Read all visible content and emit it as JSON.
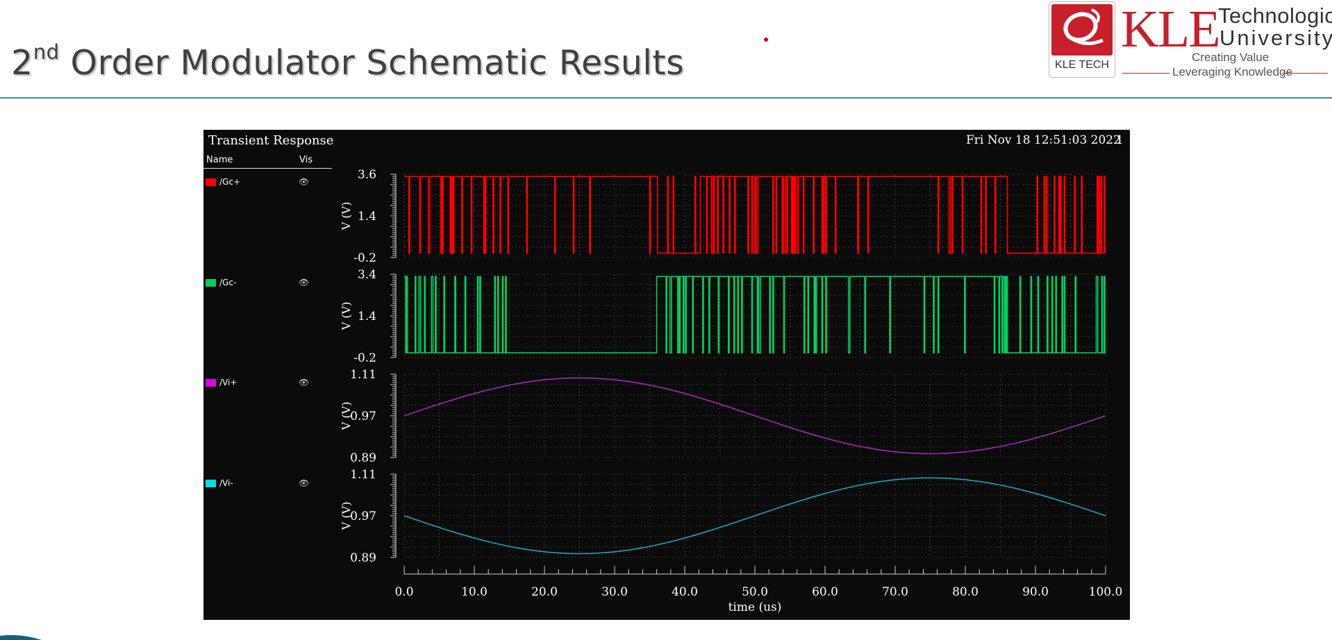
{
  "slide": {
    "title_main": "2",
    "title_sup": "nd",
    "title_rest": " Order Modulator Schematic Results"
  },
  "logo": {
    "kle": "KLE",
    "technological": "Technological",
    "university": "University",
    "badge": "KLE TECH",
    "tagline1": "Creating Value",
    "tagline2": "Leveraging Knowledge"
  },
  "colors": {
    "accent_rule": "#2e8ea8",
    "brand_red": "#c8202a"
  },
  "viewer": {
    "title": "Transient Response",
    "timestamp": "Fri Nov 18 12:51:03 2022",
    "page_number": "1",
    "col_name": "Name",
    "col_vis": "Vis",
    "visibility_icon": "eye-icon",
    "signals": [
      {
        "name": "/Gc+",
        "color": "#ff0000"
      },
      {
        "name": "/Gc-",
        "color": "#00d060"
      },
      {
        "name": "/Vi+",
        "color": "#e000e0"
      },
      {
        "name": "/Vi-",
        "color": "#00e0e0"
      }
    ]
  },
  "chart_data": {
    "type": "line",
    "xlabel": "time (us)",
    "xlim": [
      0,
      100
    ],
    "x_ticks": [
      "0.0",
      "10.0",
      "20.0",
      "30.0",
      "40.0",
      "50.0",
      "60.0",
      "70.0",
      "80.0",
      "90.0",
      "100.0"
    ],
    "grid": true,
    "panels": [
      {
        "series": "/Gc+",
        "color": "#ff0000",
        "kind": "digital",
        "ylabel": "V (V)",
        "ylim": [
          -0.2,
          3.6
        ],
        "y_ticks": [
          "3.6",
          "1.4",
          "-0.2"
        ],
        "low": 0.0,
        "high": 3.5,
        "high_intervals_us": [
          [
            0,
            36
          ],
          [
            42,
            86
          ]
        ]
      },
      {
        "series": "/Gc-",
        "color": "#00d060",
        "kind": "digital",
        "ylabel": "V (V)",
        "ylim": [
          -0.2,
          3.4
        ],
        "y_ticks": [
          "3.4",
          "1.4",
          "-0.2"
        ],
        "low": 0.0,
        "high": 3.3,
        "high_intervals_us": [
          [
            36,
            86
          ]
        ]
      },
      {
        "series": "/Vi+",
        "color": "#a32ab4",
        "kind": "sine",
        "ylabel": "V (V)",
        "ylim": [
          0.89,
          1.11
        ],
        "y_ticks": [
          "1.11",
          "0.97",
          "0.89"
        ],
        "offset": 1.0,
        "amplitude": 0.1,
        "period_us": 100,
        "phase": "sin"
      },
      {
        "series": "/Vi-",
        "color": "#1aa7b8",
        "kind": "sine",
        "ylabel": "V (V)",
        "ylim": [
          0.89,
          1.11
        ],
        "y_ticks": [
          "1.11",
          "0.97",
          "0.89"
        ],
        "offset": 1.0,
        "amplitude": -0.1,
        "period_us": 100,
        "phase": "sin"
      }
    ]
  }
}
